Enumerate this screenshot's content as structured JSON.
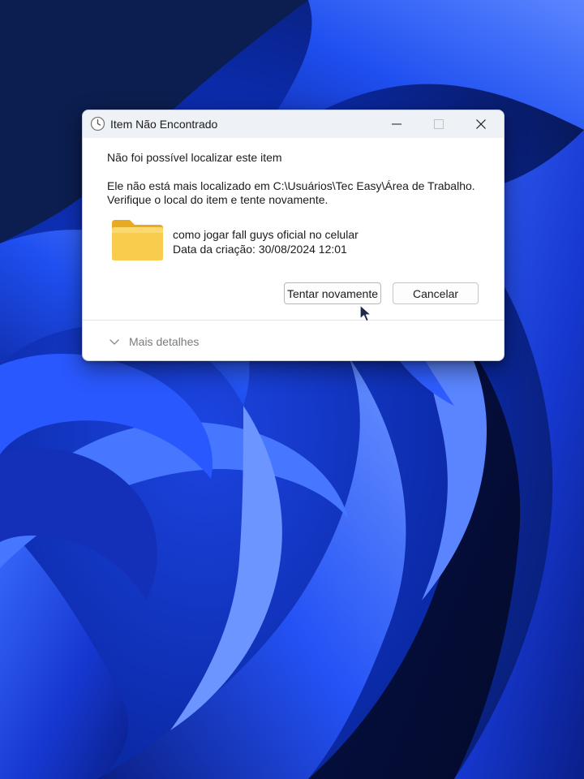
{
  "dialog": {
    "title": "Item Não Encontrado",
    "heading": "Não foi possível localizar este item",
    "message_line1": "Ele não está mais localizado em C:\\Usuários\\Tec Easy\\Área de Trabalho.",
    "message_line2": "Verifique o local do item e tente novamente.",
    "item": {
      "name": "como jogar fall guys oficial no celular",
      "date": "Data da criação: 30/08/2024 12:01",
      "icon": "folder-icon"
    },
    "buttons": {
      "retry": "Tentar novamente",
      "cancel": "Cancelar"
    },
    "details_label": "Mais detalhes",
    "title_icon": "clock-icon"
  },
  "colors": {
    "wallpaper_dark": "#0a1d6e",
    "wallpaper_bright": "#2f5cff",
    "folder": "#f7c84a",
    "titlebar": "#eef1f6"
  }
}
